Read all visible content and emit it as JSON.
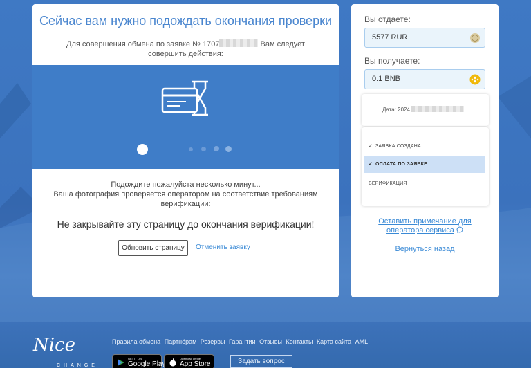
{
  "main": {
    "title": "Сейчас вам нужно подождать окончания проверки",
    "subtitle_prefix": "Для совершения обмена по заявке № 1707",
    "subtitle_suffix": " Вам следует совершить действия:",
    "wait_line1": "Подождите пожалуйста несколько минут...",
    "wait_line2": "Ваша фотография проверяется оператором на соответствие требованиям верификации:",
    "warning": "Не закрывайте эту страницу до окончания верификации!",
    "refresh_label": "Обновить страницу",
    "cancel_label": "Отменить заявку",
    "icon": "card-hourglass-icon"
  },
  "sidebar": {
    "give_label": "Вы отдаете:",
    "give_value": "5577 RUR",
    "receive_label": "Вы получаете:",
    "receive_value": "0.1",
    "receive_currency": "BNB",
    "date_prefix": "Дата: 2024",
    "steps": [
      {
        "label": "ЗАЯВКА СОЗДАНА",
        "check": "✓"
      },
      {
        "label": "ОПЛАТА ПО ЗАЯВКЕ",
        "check": "✓"
      },
      {
        "label": "ВЕРИФИКАЦИЯ",
        "check": ""
      }
    ],
    "note_link_line1": "Оставить примечание для",
    "note_link_line2": "оператора сервиса",
    "back_link": "Вернуться назад",
    "colors": {
      "accent": "#3a8ad6",
      "input_bg": "#eaf4fb",
      "bnb": "#f0b90b"
    }
  },
  "footer": {
    "logo_text": "Nice",
    "logo_sub": "CHANGE",
    "links": [
      "Правила обмена",
      "Партнёрам",
      "Резервы",
      "Гарантии",
      "Отзывы",
      "Контакты",
      "Карта сайта",
      "AML"
    ],
    "google_small": "GET IT ON",
    "google_big": "Google Play",
    "apple_small": "Download on the",
    "apple_big": "App Store",
    "ask_label": "Задать вопрос"
  }
}
